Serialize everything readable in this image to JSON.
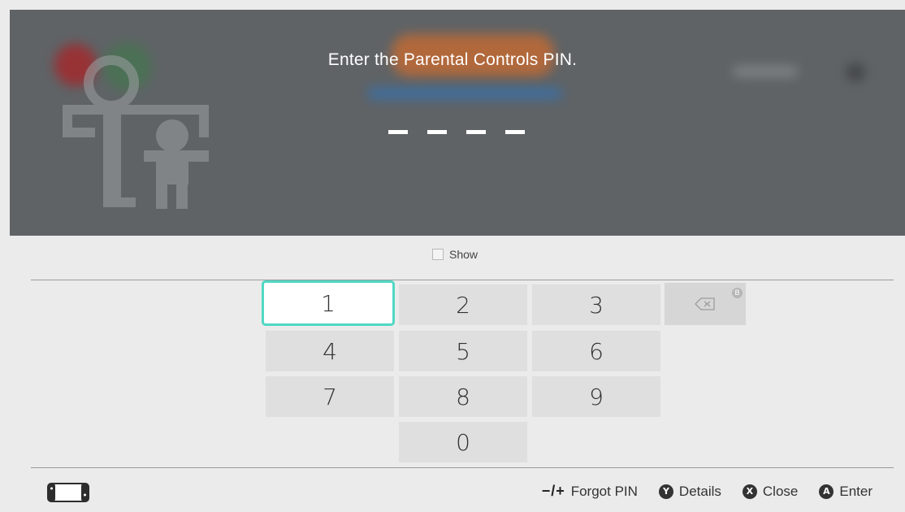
{
  "dialog": {
    "title": "Enter the Parental Controls PIN."
  },
  "pin": {
    "length": 4,
    "entered": ""
  },
  "show_toggle": {
    "label": "Show",
    "checked": false
  },
  "keypad": {
    "keys": [
      "1",
      "2",
      "3",
      "4",
      "5",
      "6",
      "7",
      "8",
      "9",
      "0"
    ],
    "selected": "1",
    "backspace_badge": "B"
  },
  "footer": {
    "forgot_prefix": "−/+",
    "forgot_label": "Forgot PIN",
    "details_button": "Y",
    "details_label": "Details",
    "close_button": "X",
    "close_label": "Close",
    "enter_button": "A",
    "enter_label": "Enter"
  },
  "colors": {
    "overlay": "#5f6366",
    "selection": "#4fd8c4",
    "key_bg": "#dfdfdf",
    "page_bg": "#ebebeb"
  },
  "icons": {
    "family": "parental-controls-icon",
    "controller": "handheld-console-icon",
    "backspace": "backspace-icon"
  }
}
